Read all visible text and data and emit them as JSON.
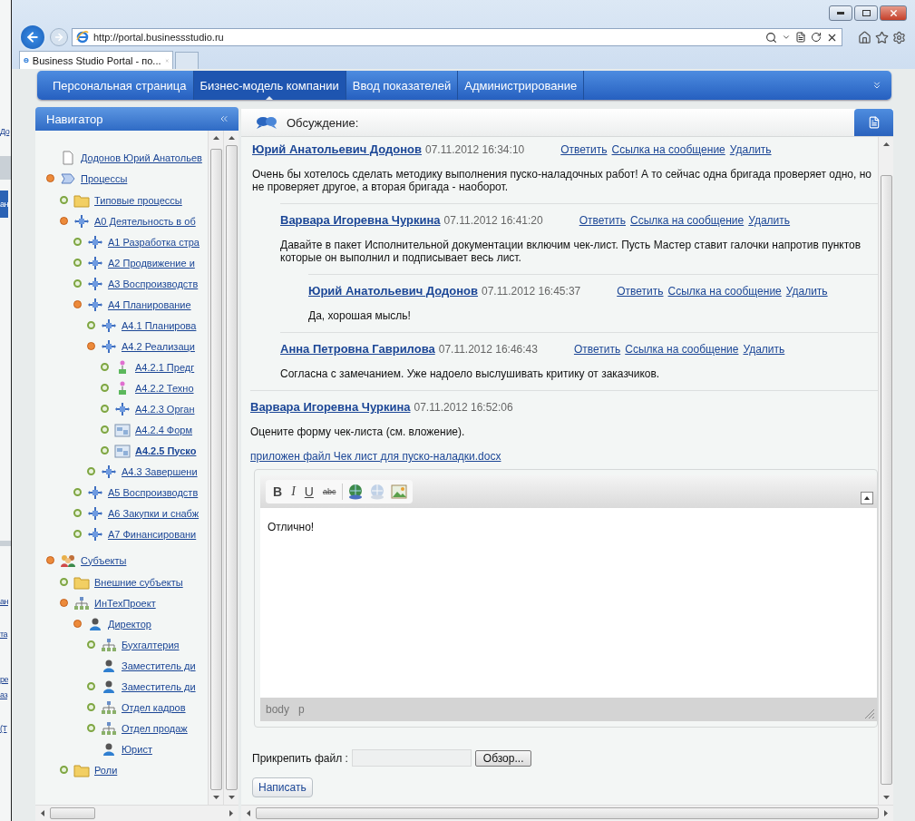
{
  "background_window": {
    "fragments": [
      {
        "text": "До",
        "kind": "link"
      },
      {
        "text": "ан",
        "kind": "bar"
      },
      {
        "text": "ан",
        "kind": "link"
      },
      {
        "text": "та",
        "kind": "link"
      },
      {
        "text": "ре",
        "kind": "link"
      },
      {
        "text": "аз",
        "kind": "link"
      },
      {
        "text": "(Т",
        "kind": "link"
      }
    ]
  },
  "browser": {
    "address": "http://portal.businessstudio.ru",
    "tab_title": "Business Studio Portal - по..."
  },
  "nav": {
    "items": [
      {
        "label": "Персональная страница",
        "selected": false
      },
      {
        "label": "Бизнес-модель компании",
        "selected": true
      },
      {
        "label": "Ввод показателей",
        "selected": false
      },
      {
        "label": "Администрирование",
        "selected": false
      }
    ]
  },
  "navigator": {
    "title": "Навигатор",
    "tree": [
      {
        "label": "Додонов Юрий Анатольев",
        "kind": "document",
        "selected": false
      },
      {
        "label": "Процессы",
        "kind": "process",
        "expanded": true,
        "selected": false,
        "children": [
          {
            "label": "Типовые процессы",
            "kind": "folder",
            "expanded": false,
            "selected": false
          },
          {
            "label": "А0 Деятельность в об",
            "kind": "diagram",
            "expanded": true,
            "selected": false,
            "children": [
              {
                "label": "А1 Разработка стра",
                "kind": "diagram",
                "expanded": false,
                "selected": false
              },
              {
                "label": "А2 Продвижение и",
                "kind": "diagram",
                "expanded": false,
                "selected": false
              },
              {
                "label": "А3 Воспроизводств",
                "kind": "diagram",
                "expanded": false,
                "selected": false
              },
              {
                "label": "А4 Планирование",
                "kind": "diagram",
                "expanded": true,
                "selected": false,
                "children": [
                  {
                    "label": "А4.1 Планирова",
                    "kind": "diagram",
                    "expanded": false,
                    "selected": false
                  },
                  {
                    "label": "А4.2 Реализаци",
                    "kind": "diagram",
                    "expanded": true,
                    "selected": false,
                    "children": [
                      {
                        "label": "А4.2.1 Предг",
                        "kind": "task",
                        "expanded": false,
                        "selected": false
                      },
                      {
                        "label": "А4.2.2 Техно",
                        "kind": "task",
                        "expanded": false,
                        "selected": false
                      },
                      {
                        "label": "А4.2.3 Орган",
                        "kind": "diagram",
                        "expanded": false,
                        "selected": false
                      },
                      {
                        "label": "А4.2.4 Форм",
                        "kind": "form",
                        "expanded": false,
                        "selected": false
                      },
                      {
                        "label": "А4.2.5 Пуско",
                        "kind": "form",
                        "expanded": false,
                        "selected": true
                      }
                    ]
                  },
                  {
                    "label": "А4.3 Завершени",
                    "kind": "diagram",
                    "expanded": false,
                    "selected": false
                  }
                ]
              },
              {
                "label": "А5 Воспроизводств",
                "kind": "diagram",
                "expanded": false,
                "selected": false
              },
              {
                "label": "А6 Закупки и снабж",
                "kind": "diagram",
                "expanded": false,
                "selected": false
              },
              {
                "label": "А7 Финансировани",
                "kind": "diagram",
                "expanded": false,
                "selected": false
              }
            ]
          }
        ]
      },
      {
        "label": "Субъекты",
        "kind": "people",
        "expanded": true,
        "selected": false,
        "children": [
          {
            "label": "Внешние субъекты",
            "kind": "folder",
            "expanded": false,
            "selected": false
          },
          {
            "label": "ИнТехПроект",
            "kind": "org",
            "expanded": true,
            "selected": false,
            "children": [
              {
                "label": "Директор",
                "kind": "person",
                "expanded": true,
                "selected": false,
                "children": [
                  {
                    "label": "Бухгалтерия",
                    "kind": "org",
                    "expanded": false,
                    "selected": false
                  },
                  {
                    "label": "Заместитель ди",
                    "kind": "person",
                    "selected": false
                  },
                  {
                    "label": "Заместитель ди",
                    "kind": "person",
                    "expanded": false,
                    "selected": false
                  },
                  {
                    "label": "Отдел кадров",
                    "kind": "org",
                    "expanded": false,
                    "selected": false
                  },
                  {
                    "label": "Отдел продаж",
                    "kind": "org",
                    "expanded": false,
                    "selected": false
                  },
                  {
                    "label": "Юрист",
                    "kind": "person",
                    "selected": false
                  }
                ]
              }
            ]
          },
          {
            "label": "Роли",
            "kind": "folder",
            "expanded": false,
            "selected": false
          }
        ]
      }
    ]
  },
  "discussion": {
    "title": "Обсуждение:",
    "messages": [
      {
        "author": "Юрий Анатольевич Додонов",
        "date": "07.11.2012 16:34:10",
        "actions": [
          "Ответить",
          "Ссылка на сообщение",
          "Удалить"
        ],
        "text": "Очень бы хотелось сделать методику выполнения пуско-наладочных работ! А то сейчас одна бригада проверяет одно, но не проверяет другое, а вторая бригада - наоборот.",
        "replies": [
          {
            "author": "Варвара Игоревна Чуркина",
            "date": "07.11.2012 16:41:20",
            "actions": [
              "Ответить",
              "Ссылка на сообщение",
              "Удалить"
            ],
            "text": "Давайте в пакет Исполнительной документации включим чек-лист. Пусть Мастер ставит галочки напротив пунктов которые он выполнил и подписывает весь лист.",
            "replies": [
              {
                "author": "Юрий Анатольевич Додонов",
                "date": "07.11.2012 16:45:37",
                "actions": [
                  "Ответить",
                  "Ссылка на сообщение",
                  "Удалить"
                ],
                "text": "Да, хорошая мысль!"
              }
            ]
          },
          {
            "author": "Анна Петровна Гаврилова",
            "date": "07.11.2012 16:46:43",
            "actions": [
              "Ответить",
              "Ссылка на сообщение",
              "Удалить"
            ],
            "text": "Согласна с замечанием. Уже надоело выслушивать критику от заказчиков."
          }
        ]
      },
      {
        "author": "Варвара Игоревна Чуркина",
        "date": "07.11.2012 16:52:06",
        "text": "Оцените форму чек-листа (см. вложение).",
        "attachment": "приложен файл Чек лист для пуско-наладки.docx"
      }
    ],
    "editor": {
      "format_buttons": [
        {
          "label": "B",
          "kind": "bold"
        },
        {
          "label": "I",
          "kind": "italic"
        },
        {
          "label": "U",
          "kind": "underline"
        },
        {
          "label": "abc",
          "kind": "strike"
        }
      ],
      "tool_icons": [
        {
          "kind": "link",
          "disabled": false
        },
        {
          "kind": "unlink",
          "disabled": true
        },
        {
          "kind": "image",
          "disabled": false
        }
      ],
      "content": "Отлично!",
      "path": [
        "body",
        "p"
      ]
    },
    "attach": {
      "label": "Прикрепить файл :",
      "button": "Обзор..."
    },
    "submit": "Написать"
  }
}
